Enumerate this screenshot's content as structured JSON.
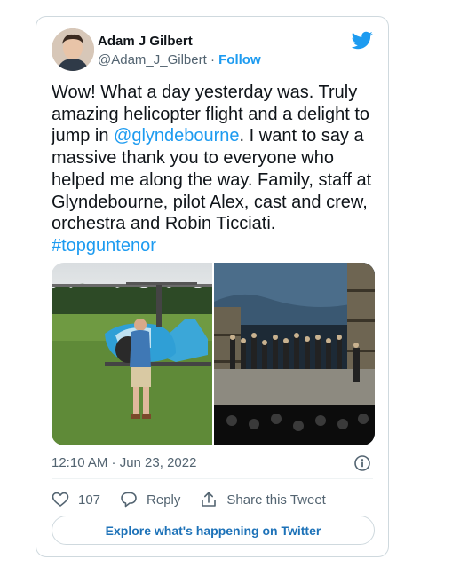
{
  "author": {
    "name": "Adam J Gilbert",
    "handle": "@Adam_J_Gilbert",
    "separator": " · ",
    "follow_label": "Follow"
  },
  "tweet": {
    "text_before": "Wow! What a day yesterday was. Truly amazing helicopter flight and a delight to jump in ",
    "mention": "@glyndebourne",
    "text_after": ". I want to say a massive thank you to everyone who helped me along the way. Family, staff at Glyndebourne, pilot Alex, cast and crew, orchestra and Robin Ticciati.",
    "hashtag": "#topguntenor",
    "timestamp": "12:10 AM · Jun 23, 2022"
  },
  "actions": {
    "like_count": "107",
    "reply_label": "Reply",
    "share_label": "Share this Tweet"
  },
  "explore_label": "Explore what's happening on Twitter",
  "colors": {
    "accent": "#1d9bf0",
    "text": "#0f1419",
    "muted": "#536471",
    "border": "#cfd9de"
  },
  "icons": [
    "twitter-bird-icon",
    "info-icon",
    "heart-icon",
    "reply-icon",
    "share-icon"
  ]
}
